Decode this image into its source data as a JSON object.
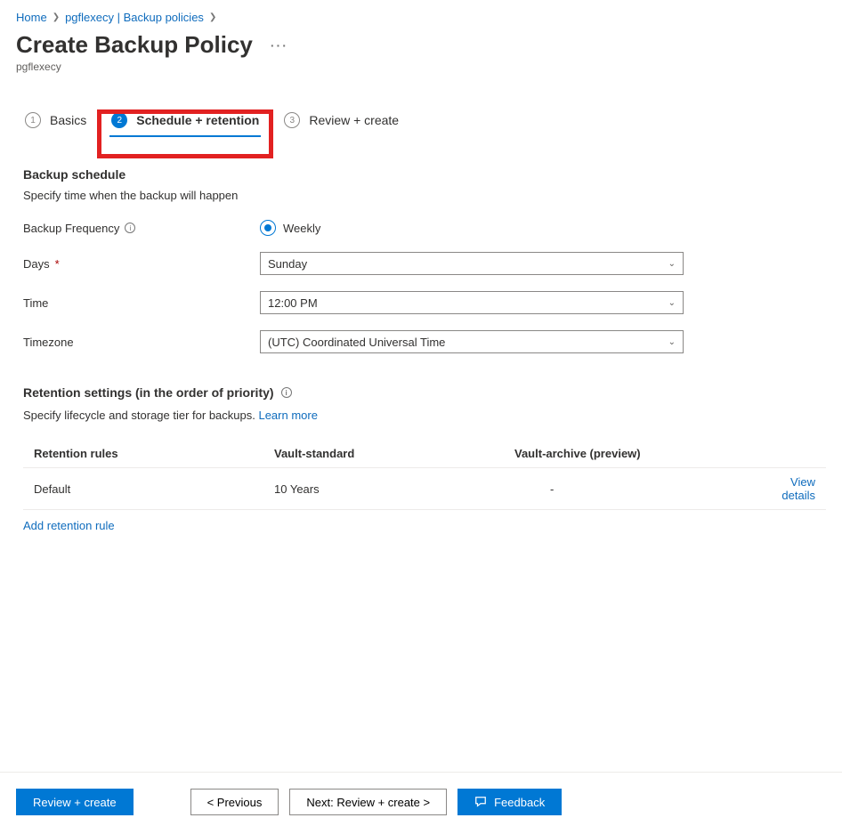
{
  "breadcrumb": {
    "home": "Home",
    "project": "pgflexecy | Backup policies"
  },
  "title": "Create Backup Policy",
  "subtitle": "pgflexecy",
  "steps": {
    "s1": {
      "num": "1",
      "label": "Basics"
    },
    "s2": {
      "num": "2",
      "label": "Schedule + retention"
    },
    "s3": {
      "num": "3",
      "label": "Review + create"
    }
  },
  "schedule": {
    "section_title": "Backup schedule",
    "section_sub": "Specify time when the backup will happen",
    "frequency_label": "Backup Frequency",
    "frequency_value": "Weekly",
    "days_label": "Days",
    "days_value": "Sunday",
    "time_label": "Time",
    "time_value": "12:00 PM",
    "tz_label": "Timezone",
    "tz_value": "(UTC) Coordinated Universal Time"
  },
  "retention": {
    "heading": "Retention settings (in the order of priority)",
    "sub_text": "Specify lifecycle and storage tier for backups. ",
    "learn_more": "Learn more",
    "col_rules": "Retention rules",
    "col_standard": "Vault-standard",
    "col_archive": "Vault-archive (preview)",
    "row_rule": "Default",
    "row_standard": "10 Years",
    "row_archive": "-",
    "view_details": "View details",
    "add_rule": "Add retention rule"
  },
  "footer": {
    "review": "Review + create",
    "prev": "< Previous",
    "next": "Next: Review + create >",
    "feedback": "Feedback"
  }
}
